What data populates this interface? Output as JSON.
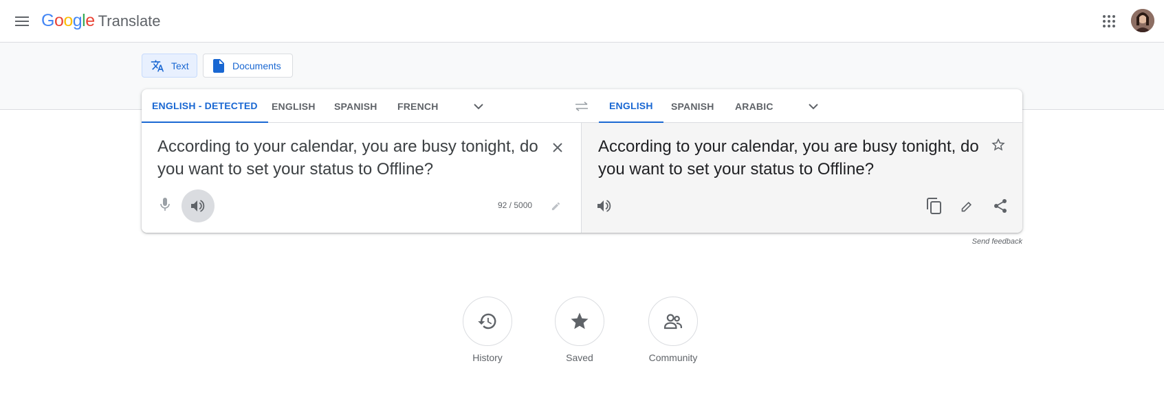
{
  "header": {
    "logo_letters": [
      "G",
      "o",
      "o",
      "g",
      "l",
      "e"
    ],
    "product_name": "Translate",
    "icons": {
      "menu": "menu-icon",
      "apps": "apps-grid-icon",
      "account": "avatar"
    }
  },
  "modes": [
    {
      "label": "Text",
      "icon": "translate-icon",
      "active": true
    },
    {
      "label": "Documents",
      "icon": "document-icon",
      "active": false
    }
  ],
  "source_languages": [
    "ENGLISH - DETECTED",
    "ENGLISH",
    "SPANISH",
    "FRENCH"
  ],
  "target_languages": [
    "ENGLISH",
    "SPANISH",
    "ARABIC"
  ],
  "source": {
    "text": "According to your calendar, you are busy tonight, do you want to set your status to Offline?",
    "char_count": "92 / 5000"
  },
  "target": {
    "text": "According to your calendar, you are busy tonight, do you want to set your status to Offline?"
  },
  "feedback_link": "Send feedback",
  "bottom_actions": [
    {
      "label": "History",
      "icon": "history-icon"
    },
    {
      "label": "Saved",
      "icon": "star-filled-icon"
    },
    {
      "label": "Community",
      "icon": "community-icon"
    }
  ],
  "colors": {
    "accent": "#1967d2",
    "logo_blue": "#4285f4",
    "logo_red": "#ea4335",
    "logo_yellow": "#fbbc05",
    "logo_green": "#34a853"
  }
}
